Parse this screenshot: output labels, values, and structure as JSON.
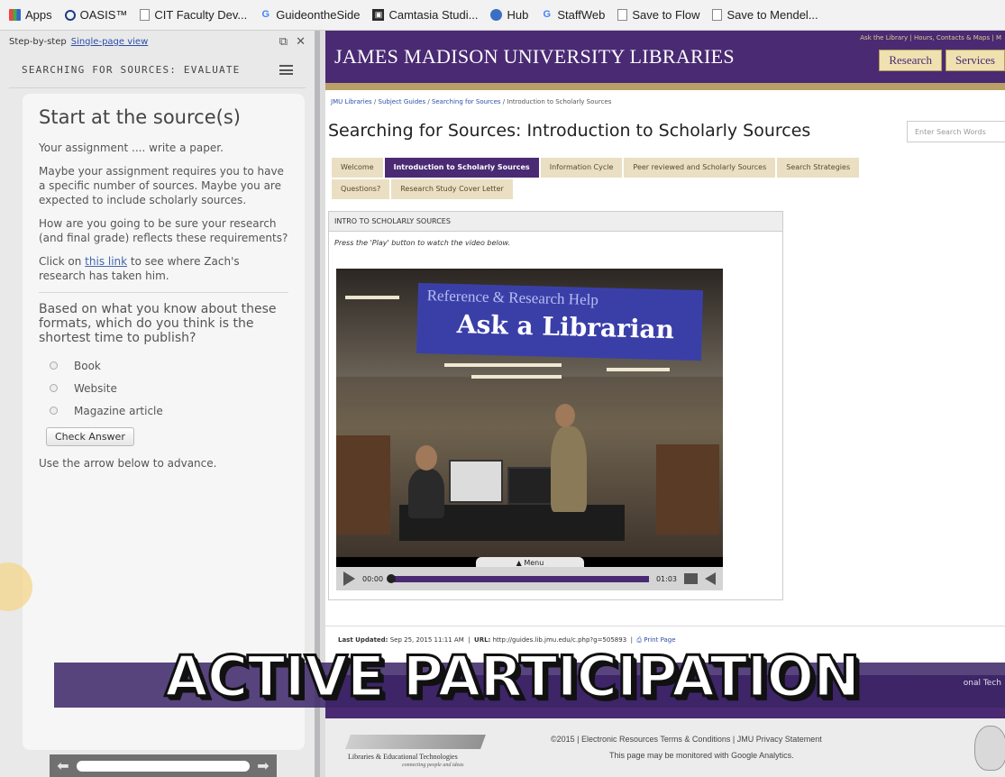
{
  "bookmarks": [
    {
      "label": "Apps",
      "icon": "apps-icon"
    },
    {
      "label": "OASIS™",
      "icon": "oasis-icon"
    },
    {
      "label": "CIT Faculty Dev...",
      "icon": "page-icon"
    },
    {
      "label": "GuideontheSide",
      "icon": "google-icon"
    },
    {
      "label": "Camtasia Studi...",
      "icon": "camtasia-icon"
    },
    {
      "label": "Hub",
      "icon": "hub-icon"
    },
    {
      "label": "StaffWeb",
      "icon": "google-icon"
    },
    {
      "label": "Save to Flow",
      "icon": "page-icon"
    },
    {
      "label": "Save to Mendel...",
      "icon": "page-icon"
    }
  ],
  "guide": {
    "mode_label": "Step-by-step",
    "single_page_link": "Single-page view",
    "header": "SEARCHING FOR SOURCES: EVALUATE",
    "title": "Start at the source(s)",
    "p1": "Your assignment .... write a paper.",
    "p2": "Maybe your assignment requires you to have a specific number of sources. Maybe you are expected to include scholarly sources.",
    "p3": "How are you going to be sure your research (and final grade) reflects these requirements?",
    "p4_before": "Click on ",
    "p4_link": "this link",
    "p4_after": " to see where Zach's research has taken him.",
    "question": "Based on what you know about these formats, which do you think is the shortest time to publish?",
    "options": [
      "Book",
      "Website",
      "Magazine article"
    ],
    "check_button": "Check Answer",
    "advance_text": "Use the arrow below to advance."
  },
  "site": {
    "title": "JAMES MADISON UNIVERSITY LIBRARIES",
    "top_links": "Ask the Library  |  Hours, Contacts & Maps  |  M",
    "header_tabs": [
      "Research",
      "Services"
    ],
    "breadcrumb": [
      "JMU Libraries",
      "Subject Guides",
      "Searching for Sources",
      "Introduction to Scholarly Sources"
    ],
    "page_title": "Searching for Sources: Introduction to Scholarly Sources",
    "search_placeholder": "Enter Search Words",
    "tabs_row1": [
      "Welcome",
      "Introduction to Scholarly Sources",
      "Information Cycle",
      "Peer reviewed and Scholarly Sources",
      "Search Strategies"
    ],
    "tabs_row2": [
      "Questions?",
      "Research Study Cover Letter"
    ],
    "active_tab": "Introduction to Scholarly Sources",
    "box_title": "INTRO TO SCHOLARLY SOURCES",
    "box_instruction": "Press the 'Play' button to watch the video below.",
    "video": {
      "banner_small": "Reference & Research Help",
      "banner_big": "Ask a Librarian",
      "menu_label": "Menu",
      "time_current": "00:00",
      "time_total": "01:03",
      "progress": 0
    },
    "last_updated_label": "Last Updated:",
    "last_updated_value": "Sep 25, 2015 11:11 AM",
    "url_label": "URL:",
    "url_value": "http://guides.lib.jmu.edu/c.php?g=505893",
    "print_label": "Print Page",
    "footer_logo": "Libraries & Educational Technologies",
    "footer_logo_sub": "connecting people and ideas",
    "footer_line1": "©2015 | Electronic Resources Terms & Conditions | JMU Privacy Statement",
    "footer_line2": "This page may be monitored with Google Analytics.",
    "band_label": "onal Tech"
  },
  "overlay": {
    "text": "ACTIVE PARTICIPATION"
  },
  "colors": {
    "jmu_purple": "#4a2a73",
    "jmu_gold": "#b9a066",
    "tab_bg": "#eadfc3"
  }
}
